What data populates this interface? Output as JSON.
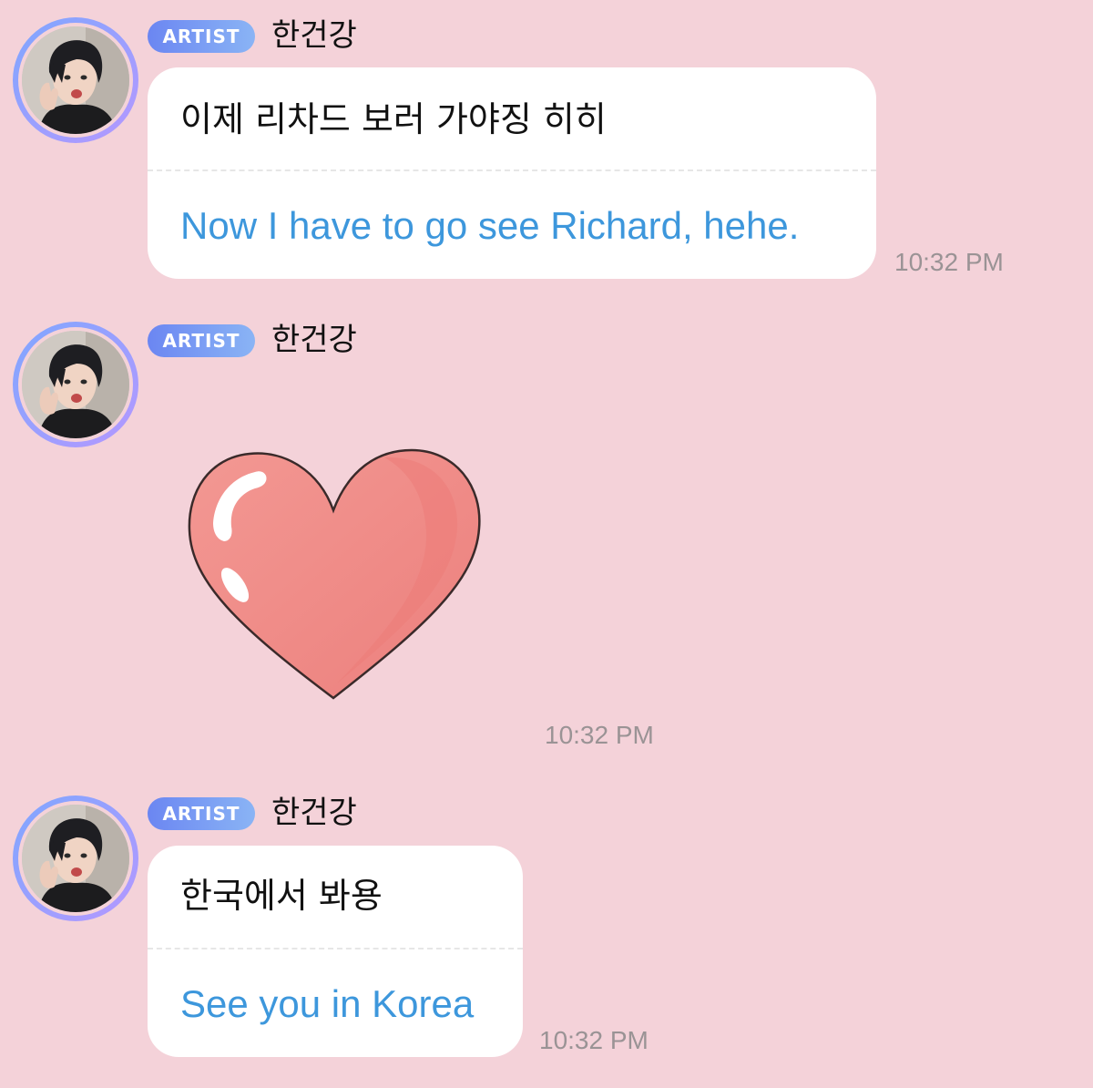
{
  "messages": [
    {
      "badge": "ARTIST",
      "name": "한건강",
      "korean": "이제 리차드 보러 가야징 히히",
      "english": "Now I have to go see Richard, hehe.",
      "time": "10:32 PM"
    },
    {
      "badge": "ARTIST",
      "name": "한건강",
      "sticker": "heart-sticker",
      "time": "10:32 PM"
    },
    {
      "badge": "ARTIST",
      "name": "한건강",
      "korean": "한국에서 봐용",
      "english": "See you in Korea",
      "time": "10:32 PM"
    }
  ],
  "colors": {
    "background": "#f4d2d9",
    "translation": "#3d97dc",
    "badge_start": "#6b86f2",
    "badge_end": "#8ab4f5",
    "heart": "#f08d8a"
  }
}
